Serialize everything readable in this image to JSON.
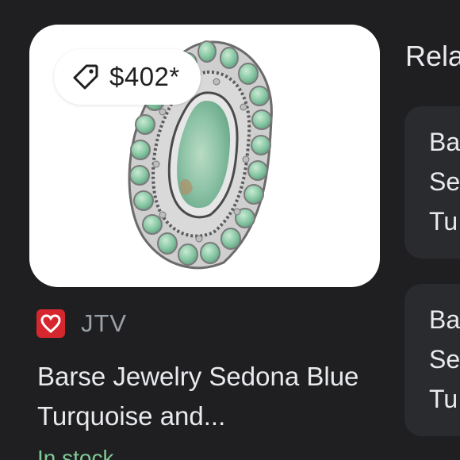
{
  "product": {
    "price": "$402*",
    "merchant": "JTV",
    "title": "Barse Jewelry Sedona Blue Turquoise and...",
    "stock": "In stock",
    "image": "turquoise-ring-icon"
  },
  "icons": {
    "price_tag": "tag-icon",
    "merchant_logo": "jtv-heart-logo"
  },
  "related": {
    "heading": "Rela",
    "cards": [
      {
        "lines": [
          "Ba",
          "Se",
          "Tu"
        ]
      },
      {
        "lines": [
          "Ba",
          "Se",
          "Tu"
        ]
      }
    ]
  },
  "colors": {
    "background": "#1f1f21",
    "card": "#2a2b2e",
    "stock_green": "#81c995",
    "merchant_red": "#d6262e"
  }
}
